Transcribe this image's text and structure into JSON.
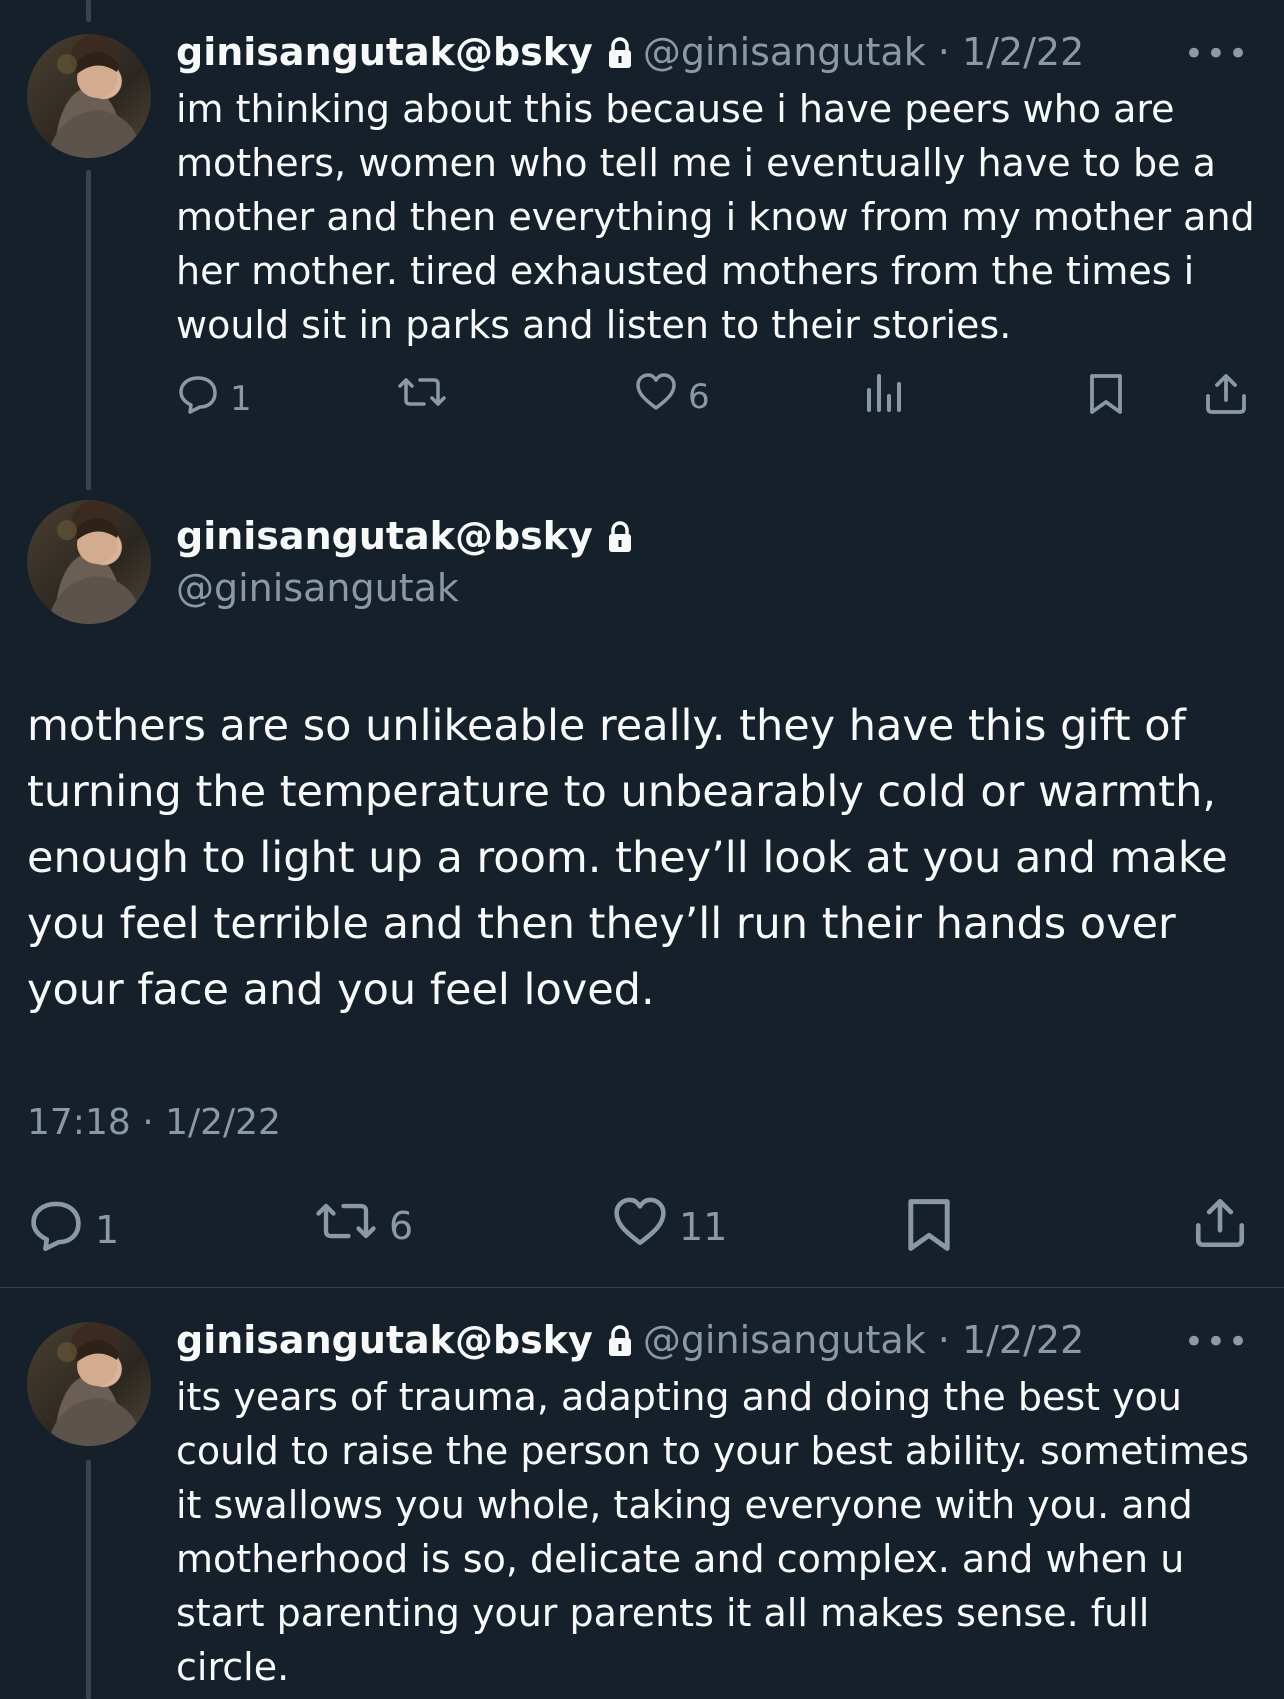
{
  "reply1": {
    "name": "ginisangutak@bsky",
    "handle": "@ginisangutak",
    "date": "· 1/2/22",
    "more": "•••",
    "text": "im thinking about this because i have peers who are mothers, women who tell me i eventually have to be a mother and then everything i know from my mother and her mother. tired exhausted mothers from the times i would sit in parks and listen to their stories.",
    "replies": "1",
    "likes": "6"
  },
  "main_post": {
    "name": "ginisangutak@bsky",
    "handle": "@ginisangutak",
    "text": "mothers are so unlikeable really. they have this gift of turning the temperature to unbearably cold or warmth, enough to light up a room. they’ll look at you and make you feel terrible and then they’ll run their hands over your face and you feel loved.",
    "timestamp": "17:18 · 1/2/22",
    "replies": "1",
    "reposts": "6",
    "likes": "11"
  },
  "reply2": {
    "name": "ginisangutak@bsky",
    "handle": "@ginisangutak",
    "date": "· 1/2/22",
    "more": "•••",
    "text": "its years of trauma, adapting and doing the best you could to raise the person to your best ability. sometimes it swallows you whole, taking everyone with you. and motherhood is so, delicate and complex. and when u start parenting your parents it all makes sense. full circle."
  },
  "icons": [
    "reply-icon",
    "repost-icon",
    "like-icon",
    "views-icon",
    "bookmark-icon",
    "share-icon",
    "lock-icon",
    "more-icon"
  ],
  "colors": {
    "background": "#15202b",
    "text": "#f7f9f9",
    "secondary": "#8b98a5",
    "line": "#38444d"
  }
}
